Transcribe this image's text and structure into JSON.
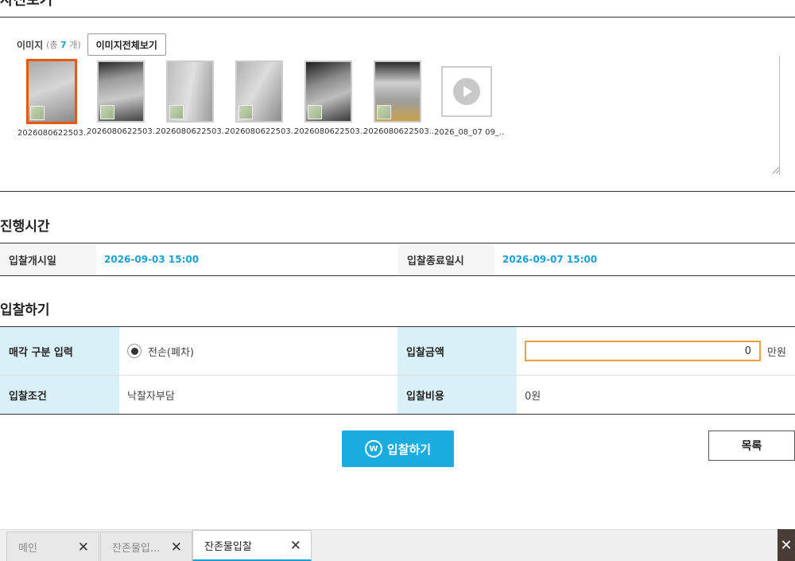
{
  "photo_section": {
    "title": "사진보기",
    "images_label": "이미지",
    "count_prefix": "(총",
    "count_value": "7",
    "count_suffix": "개)",
    "view_all_button": "이미지전체보기",
    "images": [
      {
        "name": "2026080622503..",
        "selected": true
      },
      {
        "name": "2026080622503..",
        "selected": false
      },
      {
        "name": "2026080622503..",
        "selected": false
      },
      {
        "name": "2026080622503..",
        "selected": false
      },
      {
        "name": "2026080622503..",
        "selected": false
      },
      {
        "name": "2026080622503..",
        "selected": false
      }
    ],
    "video": {
      "name": "2026_08_07 09_..",
      "icon": "play-icon"
    }
  },
  "schedule": {
    "title": "진행시간",
    "start_label": "입찰개시일",
    "start_value": "2026-09-03 15:00",
    "end_label": "입찰종료일시",
    "end_value": "2026-09-07 15:00"
  },
  "bid": {
    "title": "입찰하기",
    "sale_type_label": "매각 구분 입력",
    "sale_type_option": "전손(폐차)",
    "amount_label": "입찰금액",
    "amount_value": "0",
    "amount_unit": "만원",
    "condition_label": "입찰조건",
    "condition_value": "낙찰자부담",
    "cost_label": "입찰비용",
    "cost_value": "0원",
    "submit_button": "입찰하기",
    "list_button": "목록"
  },
  "tabs": [
    {
      "label": "메인",
      "active": false
    },
    {
      "label": "잔존물입...",
      "active": false
    },
    {
      "label": "잔존물입찰",
      "active": true
    }
  ],
  "colors": {
    "accent": "#1aabdf",
    "selected_border": "#e8590c",
    "input_border": "#f0a03c"
  }
}
